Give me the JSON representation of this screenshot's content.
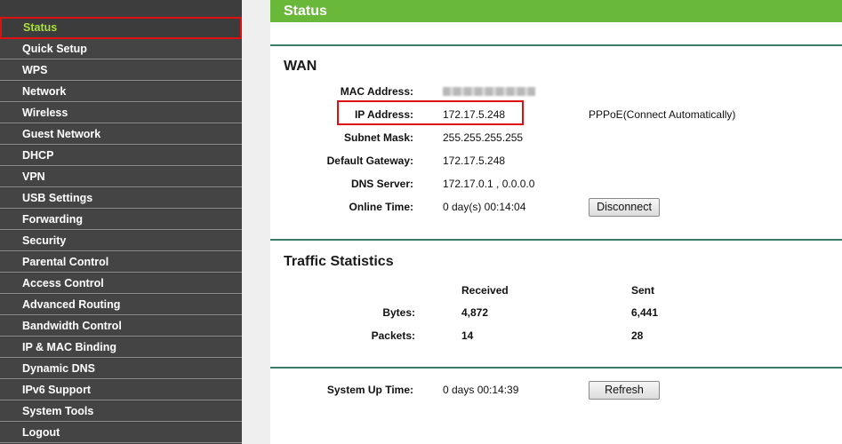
{
  "sidebar": {
    "items": [
      {
        "label": "Status",
        "active": true
      },
      {
        "label": "Quick Setup"
      },
      {
        "label": "WPS"
      },
      {
        "label": "Network"
      },
      {
        "label": "Wireless"
      },
      {
        "label": "Guest Network"
      },
      {
        "label": "DHCP"
      },
      {
        "label": "VPN"
      },
      {
        "label": "USB Settings"
      },
      {
        "label": "Forwarding"
      },
      {
        "label": "Security"
      },
      {
        "label": "Parental Control"
      },
      {
        "label": "Access Control"
      },
      {
        "label": "Advanced Routing"
      },
      {
        "label": "Bandwidth Control"
      },
      {
        "label": "IP & MAC Binding"
      },
      {
        "label": "Dynamic DNS"
      },
      {
        "label": "IPv6 Support"
      },
      {
        "label": "System Tools"
      },
      {
        "label": "Logout"
      }
    ]
  },
  "header": {
    "title": "Status"
  },
  "wan": {
    "title": "WAN",
    "mac_label": "MAC Address:",
    "ip_label": "IP Address:",
    "ip_value": "172.17.5.248",
    "connection_type": "PPPoE(Connect Automatically)",
    "subnet_label": "Subnet Mask:",
    "subnet_value": "255.255.255.255",
    "gateway_label": "Default Gateway:",
    "gateway_value": "172.17.5.248",
    "dns_label": "DNS Server:",
    "dns_value": "172.17.0.1 , 0.0.0.0",
    "online_label": "Online Time:",
    "online_value": "0 day(s) 00:14:04",
    "disconnect_label": "Disconnect"
  },
  "traffic": {
    "title": "Traffic Statistics",
    "received_header": "Received",
    "sent_header": "Sent",
    "bytes_label": "Bytes:",
    "bytes_received": "4,872",
    "bytes_sent": "6,441",
    "packets_label": "Packets:",
    "packets_received": "14",
    "packets_sent": "28"
  },
  "system": {
    "uptime_label": "System Up Time:",
    "uptime_value": "0 days 00:14:39",
    "refresh_label": "Refresh"
  },
  "colors": {
    "accent": "#6ab83a",
    "active_text": "#a9e03b",
    "highlight": "#e01010"
  }
}
